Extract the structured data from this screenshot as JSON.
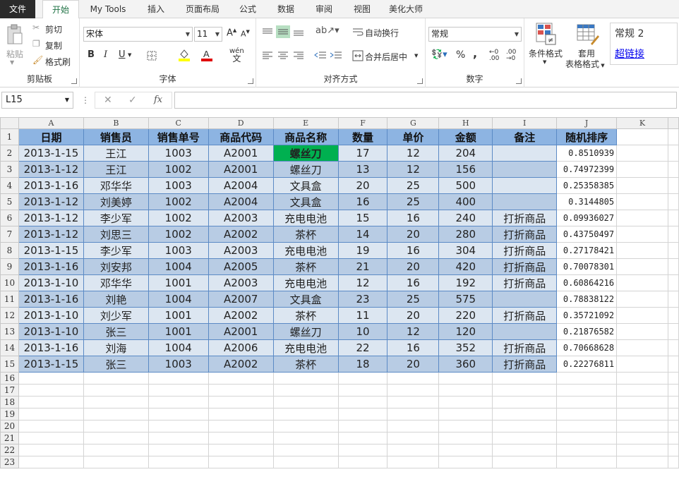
{
  "tabs": [
    {
      "label": "文件"
    },
    {
      "label": "开始"
    },
    {
      "label": "My Tools"
    },
    {
      "label": "插入"
    },
    {
      "label": "页面布局"
    },
    {
      "label": "公式"
    },
    {
      "label": "数据"
    },
    {
      "label": "审阅"
    },
    {
      "label": "视图"
    },
    {
      "label": "美化大师"
    }
  ],
  "ribbon": {
    "clipboard": {
      "label": "剪贴板",
      "paste": "粘贴",
      "cut": "剪切",
      "copy": "复制",
      "format_painter": "格式刷"
    },
    "font": {
      "label": "字体",
      "name": "宋体",
      "size": "11",
      "bold": "B",
      "italic": "I",
      "underline": "U",
      "grow": "A",
      "shrink": "A",
      "phonetic": "wén"
    },
    "alignment": {
      "label": "对齐方式",
      "wrap": "自动换行",
      "merge": "合并后居中"
    },
    "number": {
      "label": "数字",
      "format": "常规",
      "percent": "%",
      "comma": ","
    },
    "styles": {
      "conditional": "条件格式",
      "table": "套用",
      "table2": "表格格式",
      "style_normal": "常规 2",
      "style_link": "超链接"
    }
  },
  "formula_bar": {
    "name_box": "L15",
    "fx": "fx",
    "value": ""
  },
  "grid": {
    "columns": [
      "A",
      "B",
      "C",
      "D",
      "E",
      "F",
      "G",
      "H",
      "I",
      "J",
      "K"
    ],
    "rows": [
      "1",
      "2",
      "3",
      "4",
      "5",
      "6",
      "7",
      "8",
      "9",
      "10",
      "11",
      "12",
      "13",
      "14",
      "15",
      "16",
      "17",
      "18",
      "19",
      "20",
      "21",
      "22",
      "23"
    ],
    "header": [
      "日期",
      "销售员",
      "销售单号",
      "商品代码",
      "商品名称",
      "数量",
      "单价",
      "金额",
      "备注",
      "随机排序"
    ],
    "data": [
      [
        "2013-1-15",
        "王江",
        "1003",
        "A2001",
        "螺丝刀",
        "17",
        "12",
        "204",
        "",
        "0.8510939"
      ],
      [
        "2013-1-12",
        "王江",
        "1002",
        "A2001",
        "螺丝刀",
        "13",
        "12",
        "156",
        "",
        "0.74972399"
      ],
      [
        "2013-1-16",
        "邓华华",
        "1003",
        "A2004",
        "文具盒",
        "20",
        "25",
        "500",
        "",
        "0.25358385"
      ],
      [
        "2013-1-12",
        "刘美婷",
        "1002",
        "A2004",
        "文具盒",
        "16",
        "25",
        "400",
        "",
        "0.3144805"
      ],
      [
        "2013-1-12",
        "李少军",
        "1002",
        "A2003",
        "充电电池",
        "15",
        "16",
        "240",
        "打折商品",
        "0.09936027"
      ],
      [
        "2013-1-12",
        "刘思三",
        "1002",
        "A2002",
        "茶杯",
        "14",
        "20",
        "280",
        "打折商品",
        "0.43750497"
      ],
      [
        "2013-1-15",
        "李少军",
        "1003",
        "A2003",
        "充电电池",
        "19",
        "16",
        "304",
        "打折商品",
        "0.27178421"
      ],
      [
        "2013-1-16",
        "刘安邦",
        "1004",
        "A2005",
        "茶杯",
        "21",
        "20",
        "420",
        "打折商品",
        "0.70078301"
      ],
      [
        "2013-1-10",
        "邓华华",
        "1001",
        "A2003",
        "充电电池",
        "12",
        "16",
        "192",
        "打折商品",
        "0.60864216"
      ],
      [
        "2013-1-16",
        "刘艳",
        "1004",
        "A2007",
        "文具盒",
        "23",
        "25",
        "575",
        "",
        "0.78838122"
      ],
      [
        "2013-1-10",
        "刘少军",
        "1001",
        "A2002",
        "茶杯",
        "11",
        "20",
        "220",
        "打折商品",
        "0.35721092"
      ],
      [
        "2013-1-10",
        "张三",
        "1001",
        "A2001",
        "螺丝刀",
        "10",
        "12",
        "120",
        "",
        "0.21876582"
      ],
      [
        "2013-1-16",
        "刘海",
        "1004",
        "A2006",
        "充电电池",
        "22",
        "16",
        "352",
        "打折商品",
        "0.70668628"
      ],
      [
        "2013-1-15",
        "张三",
        "1003",
        "A2002",
        "茶杯",
        "18",
        "20",
        "360",
        "打折商品",
        "0.22276811"
      ]
    ]
  },
  "colors": {
    "header_fill": "#8db4e2",
    "band_light": "#dce6f1",
    "band_dark": "#b8cce4",
    "selected_fill": "#00b050",
    "accent": "#217346"
  }
}
